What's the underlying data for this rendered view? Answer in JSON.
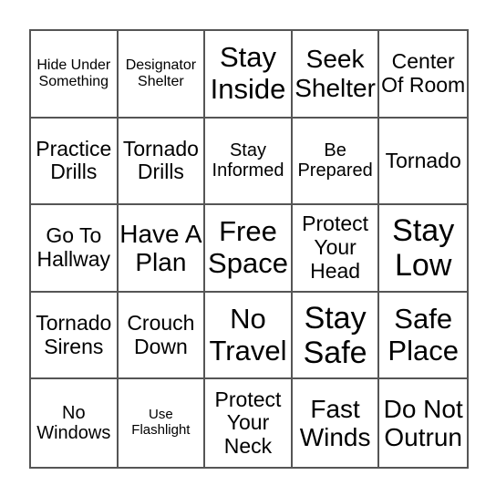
{
  "board": {
    "cells": [
      "Hide Under Something",
      "Designator Shelter",
      "Stay Inside",
      "Seek Shelter",
      "Center Of Room",
      "Practice Drills",
      "Tornado Drills",
      "Stay Informed",
      "Be Prepared",
      "Tornado",
      "Go To Hallway",
      "Have A Plan",
      "Free Space",
      "Protect Your Head",
      "Stay Low",
      "Tornado Sirens",
      "Crouch Down",
      "No Travel",
      "Stay Safe",
      "Safe Place",
      "No Windows",
      "Use Flashlight",
      "Protect Your Neck",
      "Fast Winds",
      "Do Not Outrun"
    ]
  }
}
